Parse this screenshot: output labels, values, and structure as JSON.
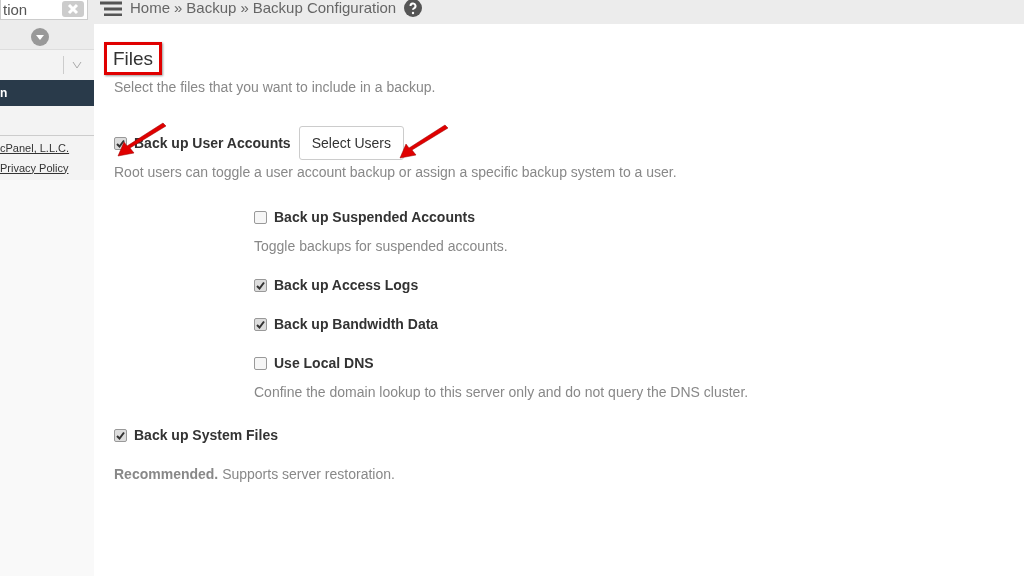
{
  "search": {
    "value": "tion"
  },
  "breadcrumb": [
    {
      "label": "Home",
      "separator": "»"
    },
    {
      "label": "Backup",
      "separator": "»"
    },
    {
      "label": "Backup Configuration"
    }
  ],
  "sidebar": {
    "active_item": "n",
    "footer_links": [
      "cPanel, L.L.C.",
      "Privacy Policy"
    ]
  },
  "files": {
    "title": "Files",
    "description": "Select the files that you want to include in a backup.",
    "options": [
      {
        "label": "Back up User Accounts",
        "checked": true,
        "button": "Select Users",
        "description": "Root users can toggle a user account backup or assign a specific backup system to a user.",
        "children": [
          {
            "label": "Back up Suspended Accounts",
            "checked": false,
            "description": "Toggle backups for suspended accounts."
          },
          {
            "label": "Back up Access Logs",
            "checked": true
          },
          {
            "label": "Back up Bandwidth Data",
            "checked": true
          },
          {
            "label": "Use Local DNS",
            "checked": false,
            "description": "Confine the domain lookup to this server only and do not query the DNS cluster."
          }
        ]
      },
      {
        "label": "Back up System Files",
        "checked": true,
        "description": "**Recommended.** Supports server restoration."
      }
    ]
  }
}
